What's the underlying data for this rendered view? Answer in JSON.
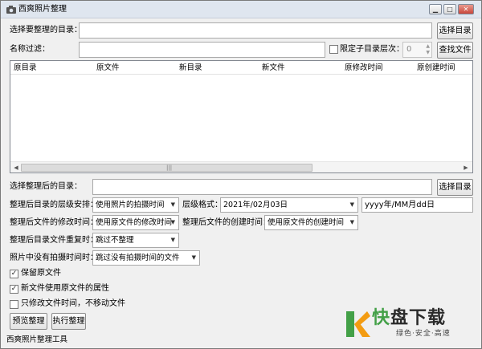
{
  "window": {
    "title": "西爽照片整理",
    "icon": "camera-icon"
  },
  "source": {
    "label": "选择要整理的目录：",
    "value": "",
    "button": "选择目录"
  },
  "filter": {
    "label": "名称过滤：",
    "value": "",
    "limit_label": "限定子目录层次：",
    "limit_checked": false,
    "limit_value": "0",
    "button": "查找文件"
  },
  "table": {
    "columns": [
      "原目录",
      "原文件",
      "新目录",
      "新文件",
      "原修改时间",
      "原创建时间"
    ],
    "rows": [],
    "scroll_grip": "|||"
  },
  "target": {
    "label": "选择整理后的目录：",
    "value": "",
    "button": "选择目录"
  },
  "options": {
    "hierarchy_label": "整理后目录的层级安排：",
    "hierarchy_value": "使用照片的拍摄时间",
    "format_label": "层级格式：",
    "format_value": "2021年/02月03日",
    "format_pattern": "yyyy年/MM月dd日",
    "mtime_label": "整理后文件的修改时间：",
    "mtime_value": "使用原文件的修改时间",
    "ctime_label": "整理后文件的创建时间：",
    "ctime_value": "使用原文件的创建时间",
    "dup_label": "整理后目录文件重复时：",
    "dup_value": "跳过不整理",
    "notime_label": "照片中没有拍摄时间时：",
    "notime_value": "跳过没有拍摄时间的文件"
  },
  "checkboxes": [
    {
      "label": "保留原文件",
      "checked": true
    },
    {
      "label": "新文件使用原文件的属性",
      "checked": true
    },
    {
      "label": "只修改文件时间，不移动文件",
      "checked": false
    }
  ],
  "actions": {
    "preview": "预览整理",
    "execute": "执行整理"
  },
  "status": "西爽照片整理工具",
  "watermark": {
    "main_a": "快",
    "main_b": "盘下载",
    "sub": "绿色·安全·高速"
  },
  "colors": {
    "titlebar": "#dfe6ef",
    "logo_green": "#43a047",
    "logo_orange": "#f39c12"
  }
}
